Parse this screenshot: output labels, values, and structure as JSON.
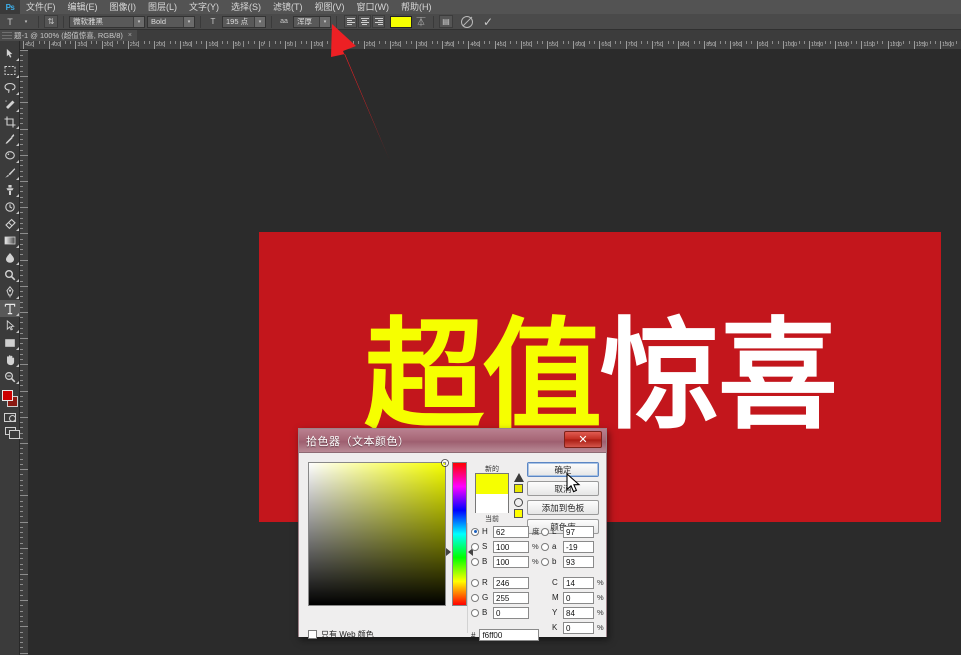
{
  "app": {
    "name": "Ps",
    "logo_text": "Ps"
  },
  "menubar": {
    "items": [
      {
        "label": "文件(F)"
      },
      {
        "label": "编辑(E)"
      },
      {
        "label": "图像(I)"
      },
      {
        "label": "图层(L)"
      },
      {
        "label": "文字(Y)"
      },
      {
        "label": "选择(S)"
      },
      {
        "label": "滤镜(T)"
      },
      {
        "label": "视图(V)"
      },
      {
        "label": "窗口(W)"
      },
      {
        "label": "帮助(H)"
      }
    ]
  },
  "options_bar": {
    "tool_icon": "type-tool-icon",
    "orientation_icon": "text-orientation-icon",
    "font_family": "微软雅黑",
    "font_style": "Bold",
    "font_size": "195 点",
    "anti_alias": "浑厚",
    "align_left": "align-left",
    "align_center": "align-center",
    "align_right": "align-right",
    "text_color_hex": "#f6ff00",
    "warp_icon": "warp-text-icon",
    "panels_icon": "toggle-panels-icon",
    "cancel_icon": "cancel-edit-icon",
    "commit_icon": "commit-edit-icon"
  },
  "document_tab": {
    "label": "题-1 @ 100% (超值惊喜, RGB/8)",
    "close": "×"
  },
  "toolbox": {
    "tools": [
      {
        "name": "move-tool",
        "glyph": "move"
      },
      {
        "name": "marquee-tool",
        "glyph": "marquee"
      },
      {
        "name": "lasso-tool",
        "glyph": "lasso"
      },
      {
        "name": "quick-selection-tool",
        "glyph": "wand"
      },
      {
        "name": "crop-tool",
        "glyph": "crop"
      },
      {
        "name": "eyedropper-tool",
        "glyph": "eyedropper"
      },
      {
        "name": "spot-healing-tool",
        "glyph": "heal"
      },
      {
        "name": "brush-tool",
        "glyph": "brush"
      },
      {
        "name": "clone-stamp-tool",
        "glyph": "stamp"
      },
      {
        "name": "history-brush-tool",
        "glyph": "history"
      },
      {
        "name": "eraser-tool",
        "glyph": "eraser"
      },
      {
        "name": "gradient-tool",
        "glyph": "gradient"
      },
      {
        "name": "blur-tool",
        "glyph": "blur"
      },
      {
        "name": "dodge-tool",
        "glyph": "dodge"
      },
      {
        "name": "pen-tool",
        "glyph": "pen"
      },
      {
        "name": "type-tool",
        "glyph": "T"
      },
      {
        "name": "path-selection-tool",
        "glyph": "pathsel"
      },
      {
        "name": "rectangle-tool",
        "glyph": "rect"
      },
      {
        "name": "hand-tool",
        "glyph": "hand"
      },
      {
        "name": "zoom-tool",
        "glyph": "zoom"
      }
    ],
    "foreground_color": "#cc0000",
    "background_color": "#8b1a12"
  },
  "ruler": {
    "h_labels": [
      "450",
      "400",
      "350",
      "300",
      "250",
      "200",
      "150",
      "100",
      "50",
      "0",
      "50",
      "100",
      "150",
      "200",
      "250",
      "300",
      "350",
      "400",
      "450",
      "500",
      "550",
      "600",
      "650",
      "700",
      "750",
      "800",
      "850",
      "900",
      "950",
      "1000",
      "1050",
      "1100",
      "1150",
      "1200",
      "1250",
      "1300"
    ],
    "unit": "px"
  },
  "canvas": {
    "background": "#2b2b2b",
    "artboard_color": "#c3161c",
    "text_part1": "超值",
    "text_part1_color": "#f6ff00",
    "text_part2": "惊喜",
    "text_part2_color": "#ffffff"
  },
  "annotation": {
    "arrow_color": "#ed2024",
    "name": "red-pointer-arrow"
  },
  "dialog": {
    "title": "拾色器（文本颜色）",
    "close_label": "✕",
    "buttons": {
      "ok": "确定",
      "cancel": "取消",
      "add_swatch": "添加到色板",
      "libraries": "颜色库"
    },
    "swatch": {
      "new_label": "新的",
      "current_label": "当前",
      "new_color": "#f6ff00",
      "current_color": "#ffffff"
    },
    "hsb": [
      {
        "label": "H",
        "value": "62",
        "unit": "度",
        "selected": true
      },
      {
        "label": "S",
        "value": "100",
        "unit": "%",
        "selected": false
      },
      {
        "label": "B",
        "value": "100",
        "unit": "%",
        "selected": false
      }
    ],
    "rgb": [
      {
        "label": "R",
        "value": "246",
        "unit": "",
        "selected": false
      },
      {
        "label": "G",
        "value": "255",
        "unit": "",
        "selected": false
      },
      {
        "label": "B",
        "value": "0",
        "unit": "",
        "selected": false
      }
    ],
    "lab": [
      {
        "label": "L",
        "value": "97",
        "unit": "",
        "selected": false
      },
      {
        "label": "a",
        "value": "-19",
        "unit": "",
        "selected": false
      },
      {
        "label": "b",
        "value": "93",
        "unit": "",
        "selected": false
      }
    ],
    "cmyk": [
      {
        "label": "C",
        "value": "14",
        "unit": "%"
      },
      {
        "label": "M",
        "value": "0",
        "unit": "%"
      },
      {
        "label": "Y",
        "value": "84",
        "unit": "%"
      },
      {
        "label": "K",
        "value": "0",
        "unit": "%"
      }
    ],
    "hex_prefix": "#",
    "hex_value": "f6ff00",
    "web_only_label": "只有 Web 颜色",
    "web_only_checked": false
  }
}
